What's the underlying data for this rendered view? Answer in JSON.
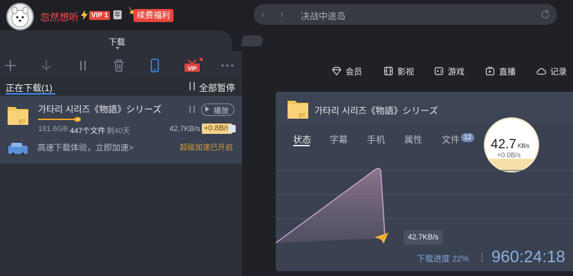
{
  "user": {
    "name": "忽然想听",
    "vip_label": "VIP 1",
    "year_badge": "年",
    "renew_label": "续费福利"
  },
  "urlbar": {
    "text": "决战中途岛"
  },
  "tabs": {
    "download_label": "下载"
  },
  "toolbar": {
    "icons": [
      "add-icon",
      "download-icon",
      "pause-icon",
      "trash-icon",
      "phone-icon",
      "vip-gift-icon",
      "more-icon"
    ],
    "vip_icon_label": "VIP"
  },
  "list": {
    "running_title": "正在下载(1)",
    "pause_all": "全部暂停",
    "task": {
      "name": "가타리 시리즈《物語》シリーズ",
      "play_label": "播放",
      "size": "181.6GB",
      "files": "447个文件",
      "remaining": "剩40天",
      "speed": "42.7KB/s",
      "boost": "+0.8B/s",
      "progress_fraction": 0.22,
      "bt_label": "BT"
    },
    "speedup_text": "高速下载体验，立即加速>",
    "speedup_expired": "超级加速已开启"
  },
  "nav": [
    {
      "label": "会员",
      "icon": "diamond-icon"
    },
    {
      "label": "影视",
      "icon": "film-icon"
    },
    {
      "label": "游戏",
      "icon": "gamepad-icon"
    },
    {
      "label": "直播",
      "icon": "tv-icon"
    },
    {
      "label": "记录",
      "icon": "cloud-icon"
    }
  ],
  "detail": {
    "name": "가타리 시리즈《物語》シリーズ",
    "bt_label": "BT",
    "tabs": [
      "状态",
      "字幕",
      "手机",
      "属性",
      "文件"
    ],
    "files_count": "12",
    "speed_value": "42.7",
    "speed_unit": "KB/s",
    "speed_boost": "+0.0B/s",
    "tooltip": "42.7KB/s",
    "progress_label": "下载进度 22%",
    "time_remaining": "960:24:18"
  },
  "colors": {
    "accent": "#3c8cf0",
    "vip_red": "#e8453c",
    "boost_gold": "#f3d48a",
    "progress_orange": "#f5a623",
    "graph_line": "#c9a3d6"
  }
}
